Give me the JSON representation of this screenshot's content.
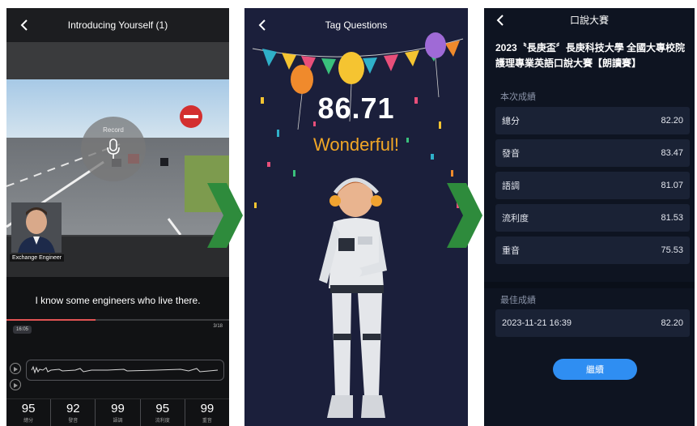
{
  "panel1": {
    "title": "Introducing Yourself (1)",
    "mic_label": "Record",
    "speaker_tag": "Exchange Engineer",
    "subtitle": "I know some engineers who live there.",
    "time": "16:05",
    "counter": "3/18",
    "progress": 0.4,
    "scores": [
      {
        "value": "95",
        "label": "總分"
      },
      {
        "value": "92",
        "label": "發音"
      },
      {
        "value": "99",
        "label": "語調"
      },
      {
        "value": "95",
        "label": "流利度"
      },
      {
        "value": "99",
        "label": "重音"
      }
    ]
  },
  "panel2": {
    "title": "Tag Questions",
    "score": "86.71",
    "message": "Wonderful!"
  },
  "panel3": {
    "title": "口說大賽",
    "contest_line1": "2023〝長庚盃〞長庚科技大學 全國大專校院",
    "contest_line2": "護理專業英語口說大賽【朗讀賽】",
    "current_label": "本次成績",
    "current": [
      {
        "label": "總分",
        "value": "82.20"
      },
      {
        "label": "發音",
        "value": "83.47"
      },
      {
        "label": "語調",
        "value": "81.07"
      },
      {
        "label": "流利度",
        "value": "81.53"
      },
      {
        "label": "重音",
        "value": "75.53"
      }
    ],
    "best_label": "最佳成績",
    "best": {
      "label": "2023-11-21 16:39",
      "value": "82.20"
    },
    "continue_label": "繼續"
  },
  "colors": {
    "accent_green": "#2e8b3c",
    "button_blue": "#2f8ef2",
    "score_orange": "#f2a726",
    "progress_red": "#e05353"
  }
}
